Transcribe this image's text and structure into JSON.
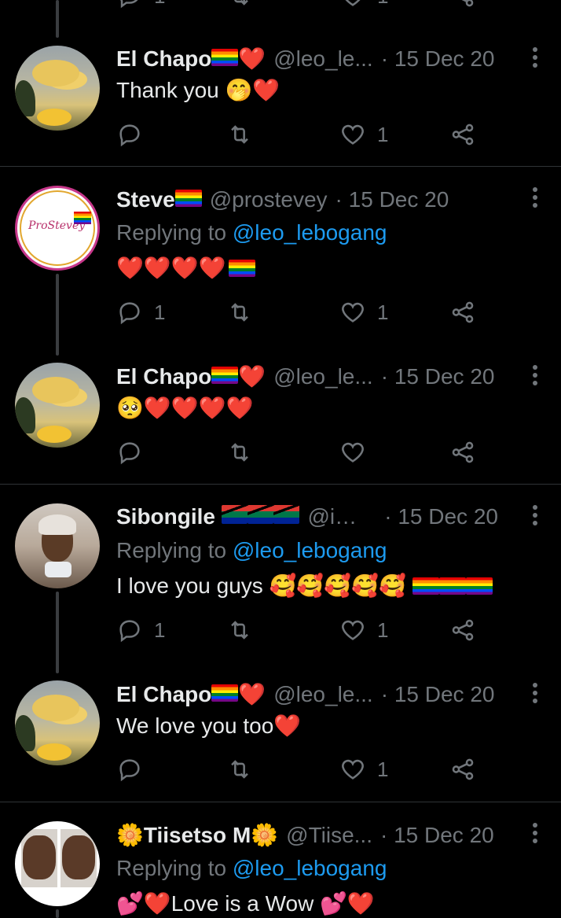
{
  "top": {
    "reply_count": "1",
    "like_count": "1"
  },
  "tweets": [
    {
      "name": "El Chapo",
      "name_suffix": "❤️",
      "handle": "@leo_le...",
      "time": "· 15 Dec 20",
      "reply_to": "",
      "body": "Thank you 🤭❤️",
      "reply_count": "",
      "like_count": "1"
    },
    {
      "name": "Steve",
      "name_suffix": "",
      "handle": "@prostevey",
      "time": "· 15 Dec 20",
      "reply_to_prefix": "Replying to",
      "reply_to": "@leo_lebogang",
      "body": "❤️❤️❤️❤️",
      "reply_count": "1",
      "like_count": "1"
    },
    {
      "name": "El Chapo",
      "name_suffix": "❤️",
      "handle": "@leo_le...",
      "time": "· 15 Dec 20",
      "reply_to": "",
      "body": "🥺❤️❤️❤️❤️",
      "reply_count": "",
      "like_count": ""
    },
    {
      "name": "Sibongile",
      "name_suffix": "",
      "handle": "@ia...",
      "time": "· 15 Dec 20",
      "reply_to_prefix": "Replying to",
      "reply_to": "@leo_lebogang",
      "body": "I love you guys 🥰🥰🥰🥰🥰",
      "reply_count": "1",
      "like_count": "1"
    },
    {
      "name": "El Chapo",
      "name_suffix": "❤️",
      "handle": "@leo_le...",
      "time": "· 15 Dec 20",
      "reply_to": "",
      "body": "We love you too❤️",
      "reply_count": "",
      "like_count": "1"
    },
    {
      "name": "🌼Tiisetso M🌼",
      "name_suffix": "",
      "handle": "@Tiise...",
      "time": "· 15 Dec 20",
      "reply_to_prefix": "Replying to",
      "reply_to": "@leo_lebogang",
      "body": "💕❤️Love is a Wow 💕❤️",
      "reply_count": "",
      "like_count": ""
    }
  ],
  "icons": {
    "reply": "reply-icon",
    "retweet": "retweet-icon",
    "like": "heart-icon",
    "share": "share-icon",
    "more": "more-vertical-icon"
  }
}
